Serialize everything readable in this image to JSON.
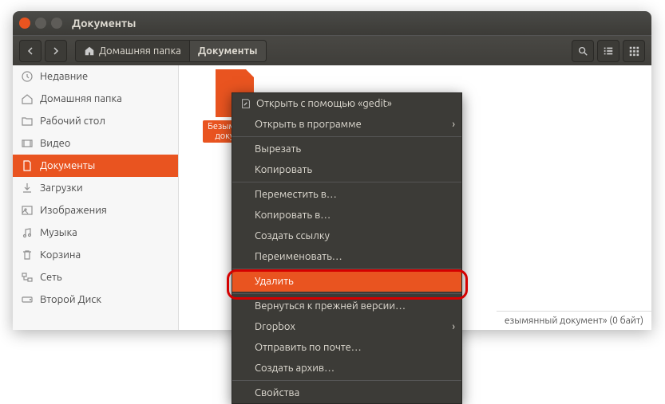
{
  "window": {
    "title": "Документы"
  },
  "toolbar": {
    "path": [
      {
        "label": "Домашняя папка",
        "icon": "home"
      },
      {
        "label": "Документы",
        "active": true
      }
    ]
  },
  "sidebar": {
    "items": [
      {
        "label": "Недавние",
        "icon": "clock"
      },
      {
        "label": "Домашняя папка",
        "icon": "home"
      },
      {
        "label": "Рабочий стол",
        "icon": "folder"
      },
      {
        "label": "Видео",
        "icon": "video"
      },
      {
        "label": "Документы",
        "icon": "doc",
        "active": true
      },
      {
        "label": "Загрузки",
        "icon": "download"
      },
      {
        "label": "Изображения",
        "icon": "image"
      },
      {
        "label": "Музыка",
        "icon": "music"
      },
      {
        "label": "Корзина",
        "icon": "trash"
      },
      {
        "label": "Сеть",
        "icon": "network"
      },
      {
        "label": "Второй Диск",
        "icon": "disk"
      }
    ]
  },
  "file": {
    "name": "Безымянный документ"
  },
  "statusbar": {
    "text": "езымянный документ»  (0 байт)"
  },
  "contextmenu": {
    "items": [
      {
        "label": "Открыть с помощью «gedit»",
        "icon": "edit"
      },
      {
        "label": "Открыть в программе",
        "submenu": true
      },
      {
        "sep": true
      },
      {
        "label": "Вырезать"
      },
      {
        "label": "Копировать"
      },
      {
        "sep": true
      },
      {
        "label": "Переместить в…"
      },
      {
        "label": "Копировать в…"
      },
      {
        "label": "Создать ссылку"
      },
      {
        "label": "Переименовать…"
      },
      {
        "sep": true
      },
      {
        "label": "Удалить",
        "highlighted": true
      },
      {
        "sep": true
      },
      {
        "label": "Вернуться к прежней версии…"
      },
      {
        "label": "Dropbox",
        "submenu": true
      },
      {
        "label": "Отправить по почте…"
      },
      {
        "label": "Создать архив…"
      },
      {
        "sep": true
      },
      {
        "label": "Свойства"
      }
    ]
  }
}
